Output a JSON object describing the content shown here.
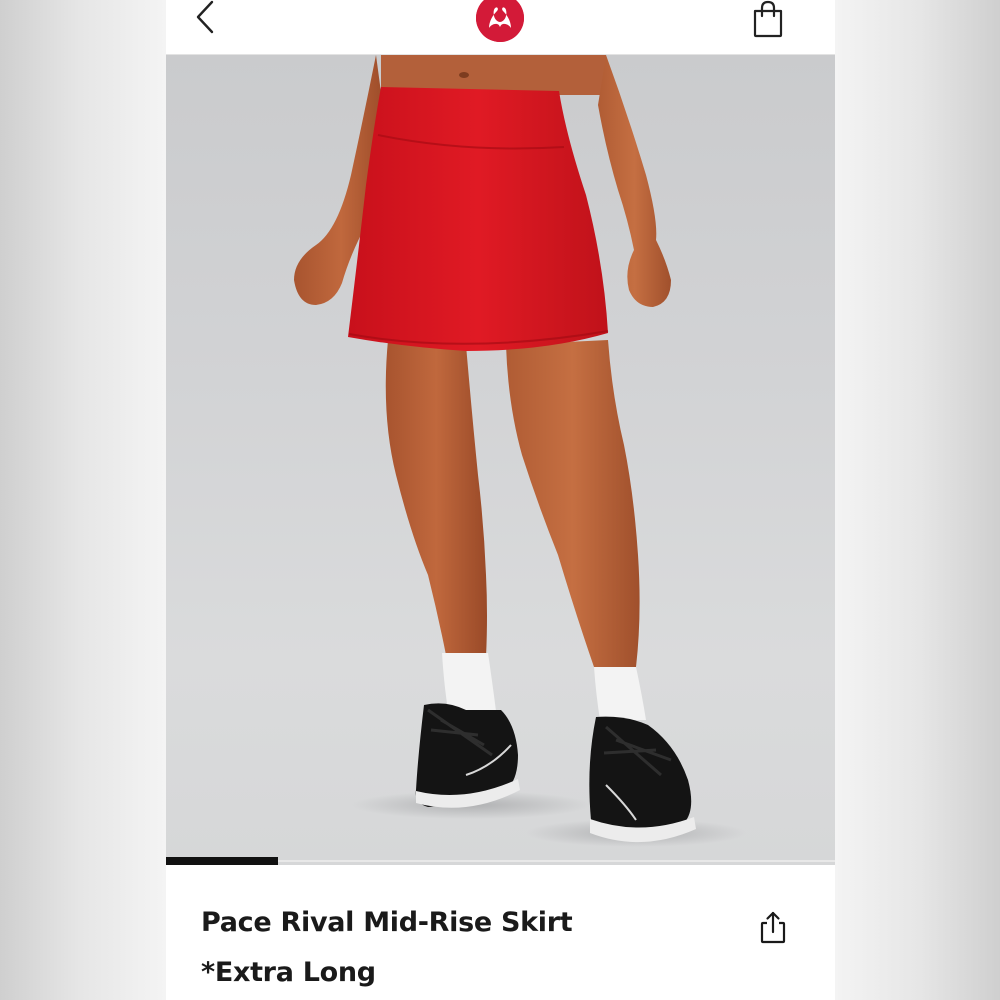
{
  "header": {
    "back_icon": "chevron-left-icon",
    "logo_icon": "lululemon-logo",
    "bag_icon": "shopping-bag-icon",
    "brand_color": "#d31a38"
  },
  "product": {
    "image_description_icon": "product-photo",
    "title_line_1": "Pace Rival Mid-Rise Skirt",
    "title_line_2": "*Extra Long",
    "share_icon": "share-icon",
    "skirt_color": "#d8161f"
  },
  "carousel": {
    "current_slide_fraction": 0.167
  }
}
